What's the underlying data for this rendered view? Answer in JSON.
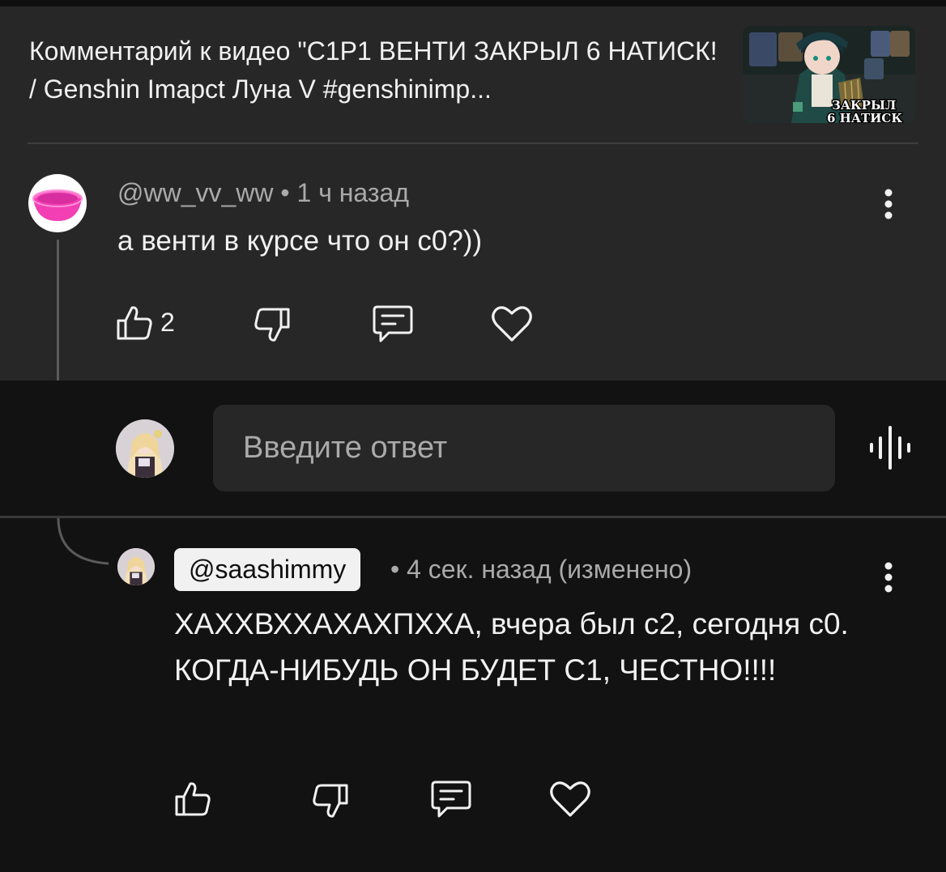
{
  "video": {
    "title": "Комментарий к видео \"C1P1 ВЕНТИ ЗАКРЫЛ 6 НАТИСК! / Genshin Imapct Луна V #genshinimp...",
    "thumbnail_overlay_line1": "ЗАКРЫЛ",
    "thumbnail_overlay_line2": "6 НАТИСК"
  },
  "parent_comment": {
    "author": "@ww_vv_ww",
    "separator": " • ",
    "time": "1 ч назад",
    "text": "а венти в курсе что он с0?))",
    "like_count": "2",
    "avatar_icon": "pink-basin-icon"
  },
  "reply_box": {
    "placeholder": "Введите ответ",
    "voice_icon": "voice-search-icon"
  },
  "reply": {
    "author": "@saashimmy",
    "meta": "• 4 сек. назад (изменено)",
    "text": "ХАХХВХХАХАХПХХА, вчера был с2, сегодня с0. КОГДА-НИБУДЬ ОН БУДЕТ С1, ЧЕСТНО!!!!"
  },
  "colors": {
    "panel_bg": "#272727",
    "page_bg": "#121212",
    "text_primary": "#f1f1f1",
    "text_secondary": "#aaaaaa",
    "basin_pink": "#f23fb4"
  }
}
